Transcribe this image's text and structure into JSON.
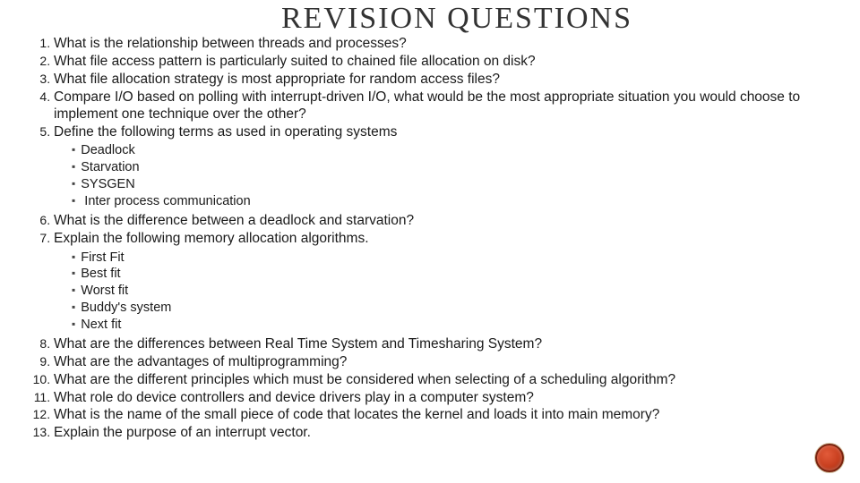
{
  "title": "REVISION QUESTIONS",
  "items": {
    "q1": "What is the relationship between threads and processes?",
    "q2": "What file access pattern is particularly suited to chained file allocation on disk?",
    "q3": "What file allocation strategy is most appropriate for random access files?",
    "q4": "Compare I/O based on polling with interrupt-driven I/O, what would be the most appropriate situation you would choose to implement one technique over the other?",
    "q5": "Define the following terms as used in operating systems",
    "q5a": "Deadlock",
    "q5b": "Starvation",
    "q5c": "SYSGEN",
    "q5d": " Inter process communication",
    "q6": "What is the difference between a deadlock and starvation?",
    "q7": "Explain the following memory allocation algorithms.",
    "q7a": "First Fit",
    "q7b": "Best fit",
    "q7c": "Worst fit",
    "q7d": "Buddy's system",
    "q7e": "Next fit",
    "q8": "What are the differences between Real Time System and Timesharing System?",
    "q9": "What are the advantages of multiprogramming?",
    "q10": "What are the different principles which must be considered when selecting of a scheduling algorithm?",
    "q11": "What role do device controllers and device drivers play in a computer system?",
    "q12": "What is the name of the small piece of code that locates the kernel and loads it into main memory?",
    "q13": "Explain the purpose of an interrupt vector."
  }
}
